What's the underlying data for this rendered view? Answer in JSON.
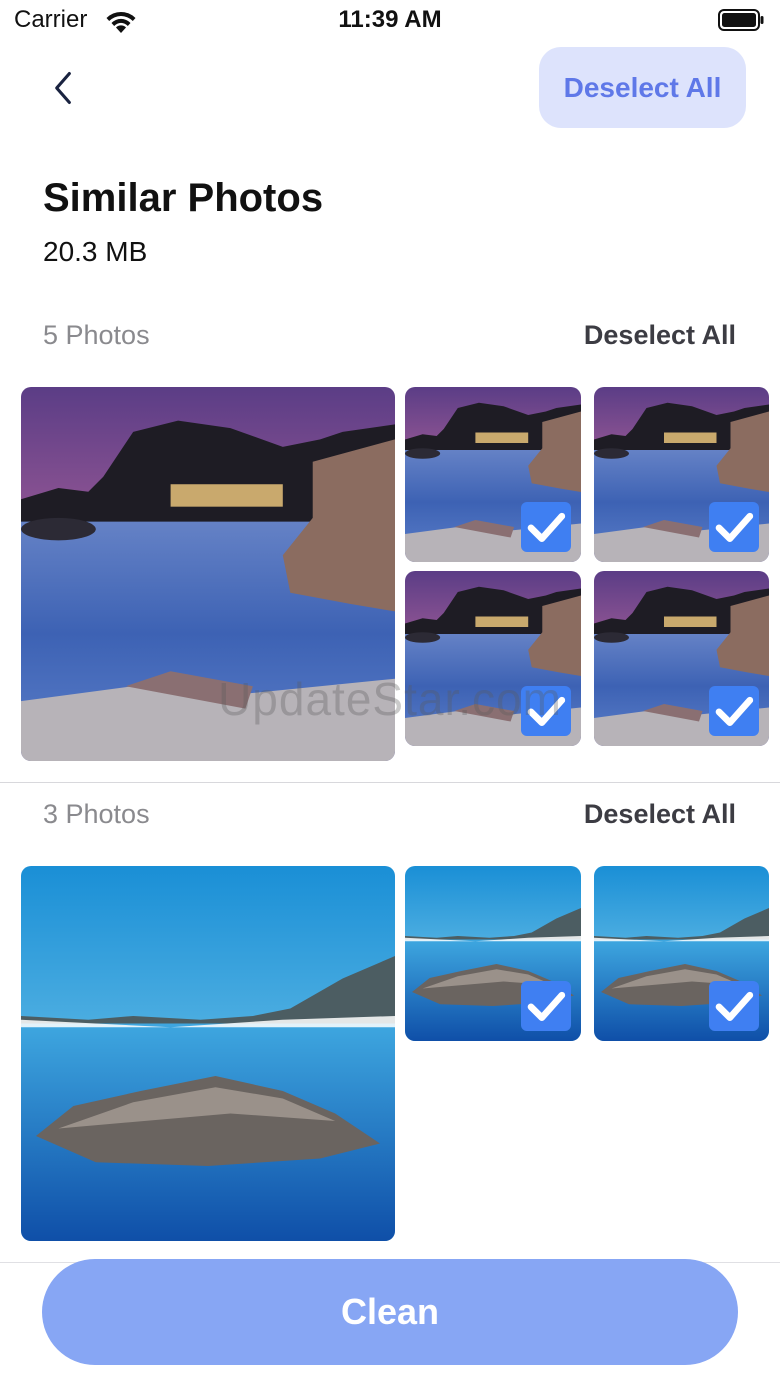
{
  "status_bar": {
    "carrier": "Carrier",
    "time": "11:39 AM"
  },
  "nav": {
    "deselect_all": "Deselect All"
  },
  "header": {
    "title": "Similar Photos",
    "size": "20.3 MB"
  },
  "groups": [
    {
      "count_label": "5 Photos",
      "deselect_label": "Deselect All",
      "scene": "coastal-village-dusk",
      "selected": [
        false,
        true,
        true,
        true,
        true
      ]
    },
    {
      "count_label": "3 Photos",
      "deselect_label": "Deselect All",
      "scene": "rock-in-lake",
      "selected": [
        false,
        true,
        true
      ]
    }
  ],
  "watermark": "UpdateStar.com",
  "clean_button": "Clean",
  "colors": {
    "accent": "#5f78e8",
    "accent_light": "#dde3fc",
    "check": "#3f7ff2",
    "clean_button": "#87a6f4"
  }
}
